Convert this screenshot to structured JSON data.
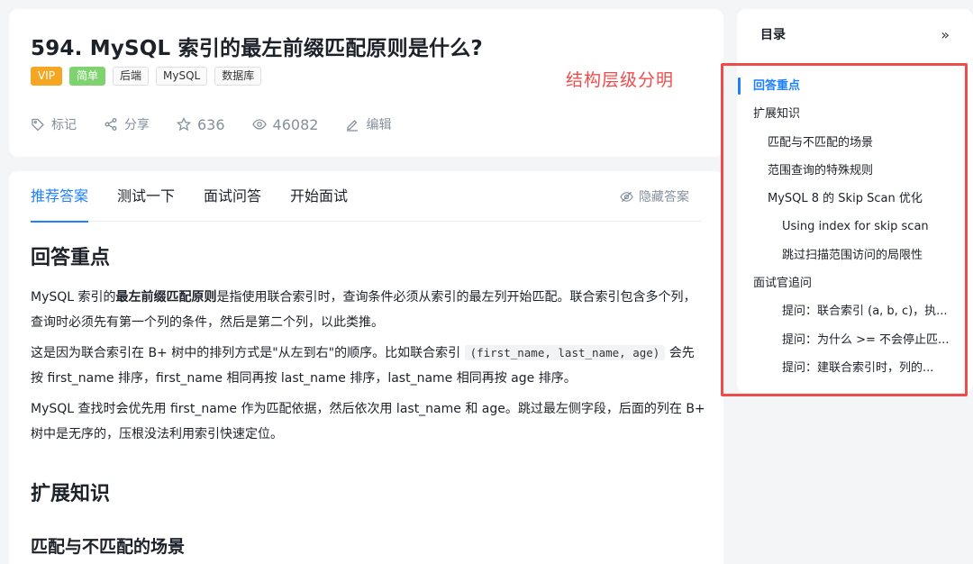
{
  "header": {
    "title": "594. MySQL 索引的最左前缀匹配原则是什么?",
    "tags": [
      "VIP",
      "简单",
      "后端",
      "MySQL",
      "数据库"
    ],
    "annotation": "结构层级分明",
    "actions": {
      "bookmark": "标记",
      "share": "分享",
      "stars": "636",
      "views": "46082",
      "edit": "编辑"
    }
  },
  "tabs": [
    "推荐答案",
    "测试一下",
    "面试问答",
    "开始面试"
  ],
  "hide_answer": "隐藏答案",
  "content": {
    "section1_title": "回答重点",
    "p1_pre": "MySQL 索引的",
    "p1_bold": "最左前缀匹配原则",
    "p1_post": "是指使用联合索引时，查询条件必须从索引的最左列开始匹配。联合索引包含多个列，查询时必须先有第一个列的条件，然后是第二个列，以此类推。",
    "p2_pre": "这是因为联合索引在 B+ 树中的排列方式是\"从左到右\"的顺序。比如联合索引",
    "p2_code": "(first_name, last_name, age)",
    "p2_post": "会先按 first_name 排序，first_name 相同再按 last_name 排序，last_name 相同再按 age 排序。",
    "p3": "MySQL 查找时会优先用 first_name 作为匹配依据，然后依次用 last_name 和 age。跳过最左侧字段，后面的列在 B+ 树中是无序的，压根没法利用索引快速定位。",
    "section2_title": "扩展知识",
    "section2_sub": "匹配与不匹配的场景"
  },
  "toc": {
    "title": "目录",
    "expand": "»",
    "items": [
      {
        "label": "回答重点",
        "level": 1,
        "active": true
      },
      {
        "label": "扩展知识",
        "level": 1
      },
      {
        "label": "匹配与不匹配的场景",
        "level": 2
      },
      {
        "label": "范围查询的特殊规则",
        "level": 2
      },
      {
        "label": "MySQL 8 的 Skip Scan 优化",
        "level": 2
      },
      {
        "label": "Using index for skip scan",
        "level": 3
      },
      {
        "label": "跳过扫描范围访问的局限性",
        "level": 3
      },
      {
        "label": "面试官追问",
        "level": 1
      },
      {
        "label": "提问：联合索引 (a, b, c)，执...",
        "level": 3
      },
      {
        "label": "提问：为什么 >= 不会停止匹...",
        "level": 3
      },
      {
        "label": "提问：建联合索引时，列的...",
        "level": 3
      }
    ]
  },
  "colors": {
    "accent": "#1e80ff",
    "vip": "#f5a623",
    "easy": "#7ed36e",
    "annotation": "#f04b4b"
  }
}
